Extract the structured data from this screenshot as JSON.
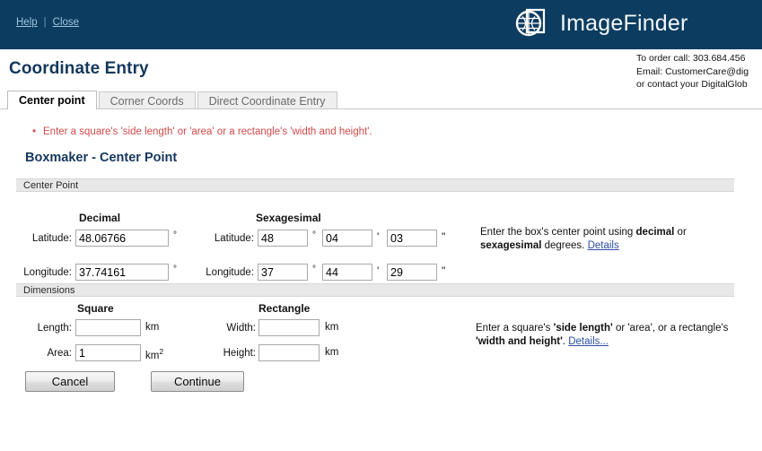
{
  "header": {
    "help_label": "Help",
    "separator": "|",
    "close_label": "Close",
    "brand_name": "ImageFinder",
    "logo_icon": "globe-grid-icon",
    "background_color": "#0c3c5f"
  },
  "contact": {
    "line1": "To order call: 303.684.456",
    "line2": "Email: CustomerCare@dig",
    "line3": "or contact your DigitalGlob"
  },
  "page": {
    "title": "Coordinate Entry",
    "note_bullet": "•",
    "note_text": "Enter a square's 'side length' or 'area' or a rectangle's 'width and height'.",
    "note_color": "#d24949",
    "section_heading": "Boxmaker - Center Point",
    "heading_color": "#15375c"
  },
  "tabs": [
    {
      "label": "Center point",
      "active": true
    },
    {
      "label": "Corner Coords",
      "active": false
    },
    {
      "label": "Direct Coordinate Entry",
      "active": false
    }
  ],
  "center_point": {
    "panel_title": "Center Point",
    "decimal": {
      "column_title": "Decimal",
      "latitude_label": "Latitude:",
      "latitude_value": "48.06766",
      "latitude_unit": "°",
      "longitude_label": "Longitude:",
      "longitude_value": "37.74161",
      "longitude_unit": "°"
    },
    "sexagesimal": {
      "column_title": "Sexagesimal",
      "latitude_label": "Latitude:",
      "latitude_deg": "48",
      "latitude_min": "04",
      "latitude_sec": "03",
      "longitude_label": "Longitude:",
      "longitude_deg": "37",
      "longitude_min": "44",
      "longitude_sec": "29",
      "deg_symbol": "°",
      "min_symbol": "'",
      "sec_symbol": "\""
    },
    "help_prefix": "Enter the box's center point using ",
    "help_bold1": "decimal",
    "help_mid": " or ",
    "help_bold2": "sexagesimal",
    "help_suffix": " degrees. ",
    "help_link": "Details"
  },
  "dimensions": {
    "panel_title": "Dimensions",
    "square": {
      "column_title": "Square",
      "length_label": "Length:",
      "length_value": "",
      "length_placeholder": "",
      "length_unit": "km",
      "area_label": "Area:",
      "area_value": "1",
      "area_placeholder": "",
      "area_unit": "km",
      "area_unit_exponent": "2"
    },
    "rectangle": {
      "column_title": "Rectangle",
      "width_label": "Width:",
      "width_value": "",
      "width_placeholder": "",
      "width_unit": "km",
      "height_label": "Height:",
      "height_value": "",
      "height_placeholder": "",
      "height_unit": "km"
    },
    "help_prefix": "Enter a square's ",
    "help_bold1": "'side length'",
    "help_mid1": " or 'area', or a rectangle's ",
    "help_bold2": "'width and height'",
    "help_suffix": ". ",
    "help_link": "Details..."
  },
  "buttons": {
    "cancel_label": "Cancel",
    "continue_label": "Continue"
  }
}
